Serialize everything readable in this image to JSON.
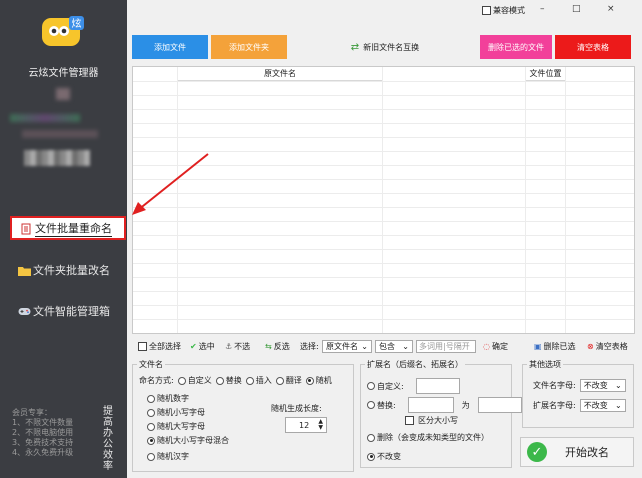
{
  "sidebar": {
    "app_name": "云炫文件管理器",
    "nav": [
      {
        "label": "文件批量重命名",
        "icon": "document-icon"
      },
      {
        "label": "文件夹批量改名",
        "icon": "folder-icon"
      },
      {
        "label": "文件智能管理箱",
        "icon": "gamepad-icon"
      }
    ],
    "promo": [
      "会员专享：",
      "1、不限文件数量",
      "2、不限电脑使用",
      "3、免费技术支持",
      "4、永久免费升级"
    ],
    "slogan": "提高办公效率"
  },
  "titlebar": {
    "compat_label": "兼容模式",
    "min": "–",
    "max": "□",
    "close": "×"
  },
  "toolbar": {
    "add_file": "添加文件",
    "add_folder": "添加文件夹",
    "swap": "新旧文件名互换",
    "delete_selected": "删除已选的文件",
    "clear_table": "清空表格"
  },
  "grid": {
    "col_original": "原文件名",
    "col_location": "文件位置"
  },
  "actions": {
    "select_all": "全部选择",
    "select": "选中",
    "unselect": "不选",
    "invert": "反选",
    "choose_label": "选择:",
    "field_select": "原文件名",
    "match_select": "包含",
    "filter_placeholder": "多词用|号隔开",
    "confirm": "确定",
    "delete_selected": "删除已选",
    "clear_table": "清空表格"
  },
  "filename_group": {
    "title": "文件名",
    "mode_label": "命名方式:",
    "modes": [
      "自定义",
      "替换",
      "插入",
      "翻译",
      "随机"
    ],
    "random_options": [
      "随机数字",
      "随机小写字母",
      "随机大写字母",
      "随机大小写字母混合",
      "随机汉字"
    ],
    "length_label": "随机生成长度:",
    "length_value": "12"
  },
  "ext_group": {
    "title": "扩展名（后缀名、拓展名）",
    "custom": "自定义:",
    "replace": "替换:",
    "to": "为",
    "case_sensitive": "区分大小写",
    "delete": "删除（会变成未知类型的文件）",
    "unchanged": "不改变"
  },
  "other_group": {
    "title": "其他选项",
    "filename_case_label": "文件名字母:",
    "filename_case_value": "不改变",
    "ext_case_label": "扩展名字母:",
    "ext_case_value": "不改变"
  },
  "start_button": "开始改名",
  "colors": {
    "sidebar": "#3b3d42",
    "blue": "#2b8fe6",
    "orange": "#f4a23a",
    "pink": "#f2409a",
    "red": "#ec1a1a",
    "highlight": "#e02020"
  }
}
